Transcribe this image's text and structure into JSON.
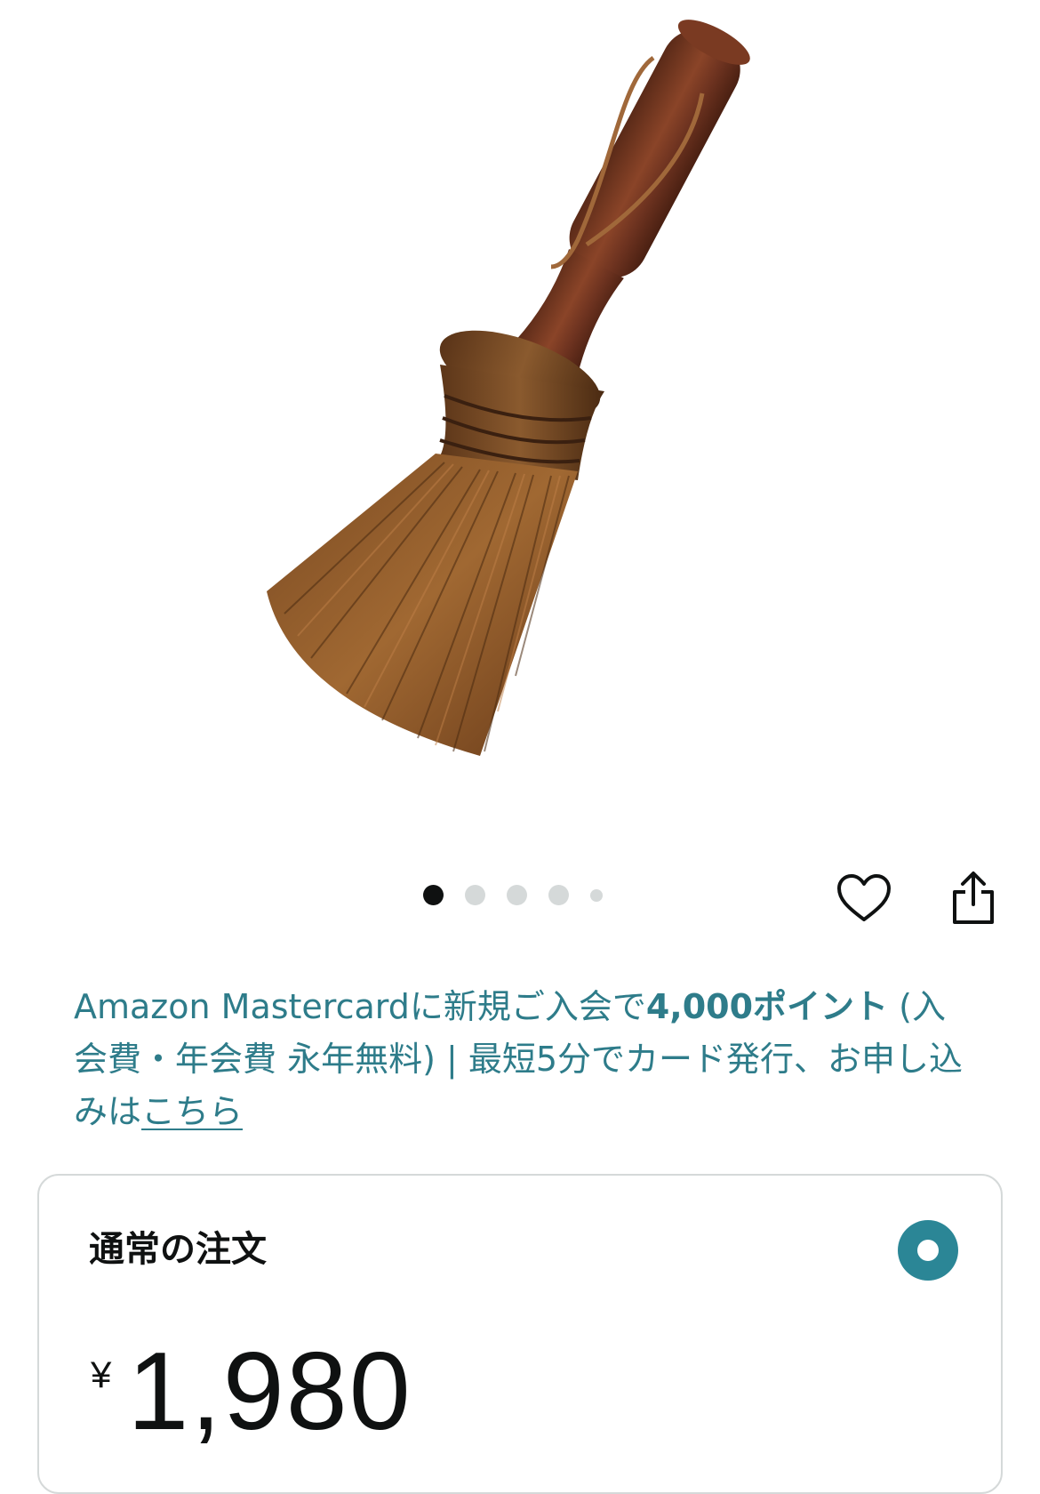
{
  "product_image": {
    "alt": "",
    "icon": "broom-image"
  },
  "carousel": {
    "total": 5,
    "active_index": 0
  },
  "actions": {
    "wishlist_icon": "heart-icon",
    "share_icon": "share-icon"
  },
  "promo": {
    "text_1": "Amazon Mastercardに新規ご入会で",
    "points": "4,000ポイント",
    "text_2": " (入会費・年会費 永年無料) | 最短5分でカード発行、お申し込みは",
    "link": "こちら",
    "color": "#2e7c8a"
  },
  "order": {
    "title": "通常の注文",
    "currency": "¥",
    "price": "1,980",
    "radio_color": "#2b8696",
    "selected": true
  }
}
